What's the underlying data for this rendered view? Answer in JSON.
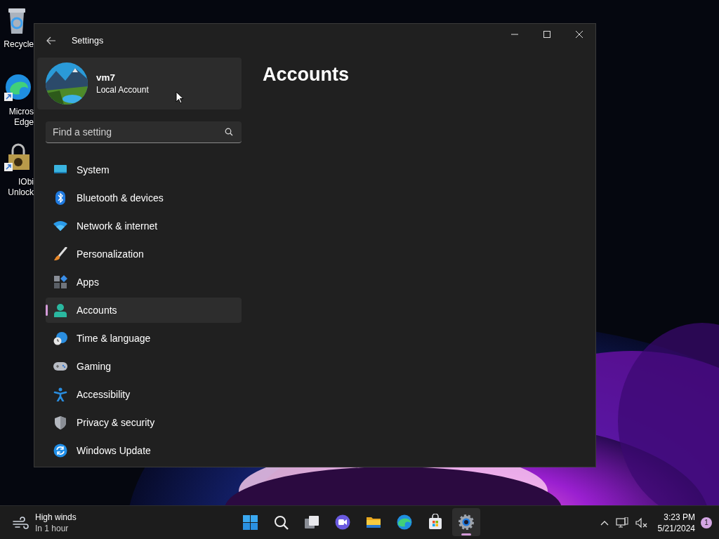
{
  "desktop_icons": [
    {
      "lines": [
        "Recycle"
      ]
    },
    {
      "lines": [
        "Micros",
        "Edge"
      ]
    },
    {
      "lines": [
        "IObi",
        "Unlock"
      ]
    }
  ],
  "window": {
    "title": "Settings"
  },
  "account": {
    "name": "vm7",
    "type": "Local Account"
  },
  "search": {
    "placeholder": "Find a setting"
  },
  "sidebar": {
    "items": [
      {
        "label": "System",
        "selected": false
      },
      {
        "label": "Bluetooth & devices",
        "selected": false
      },
      {
        "label": "Network & internet",
        "selected": false
      },
      {
        "label": "Personalization",
        "selected": false
      },
      {
        "label": "Apps",
        "selected": false
      },
      {
        "label": "Accounts",
        "selected": true
      },
      {
        "label": "Time & language",
        "selected": false
      },
      {
        "label": "Gaming",
        "selected": false
      },
      {
        "label": "Accessibility",
        "selected": false
      },
      {
        "label": "Privacy & security",
        "selected": false
      },
      {
        "label": "Windows Update",
        "selected": false
      }
    ]
  },
  "page": {
    "heading": "Accounts"
  },
  "taskbar": {
    "weather": {
      "title": "High winds",
      "subtitle": "In 1 hour"
    },
    "apps": [
      {
        "selected": false
      },
      {
        "selected": false
      },
      {
        "selected": false
      },
      {
        "selected": false
      },
      {
        "selected": false
      },
      {
        "selected": false
      },
      {
        "selected": false
      },
      {
        "selected": true
      }
    ],
    "clock": {
      "time": "3:23 PM",
      "date": "5/21/2024"
    },
    "notifications": "1"
  }
}
